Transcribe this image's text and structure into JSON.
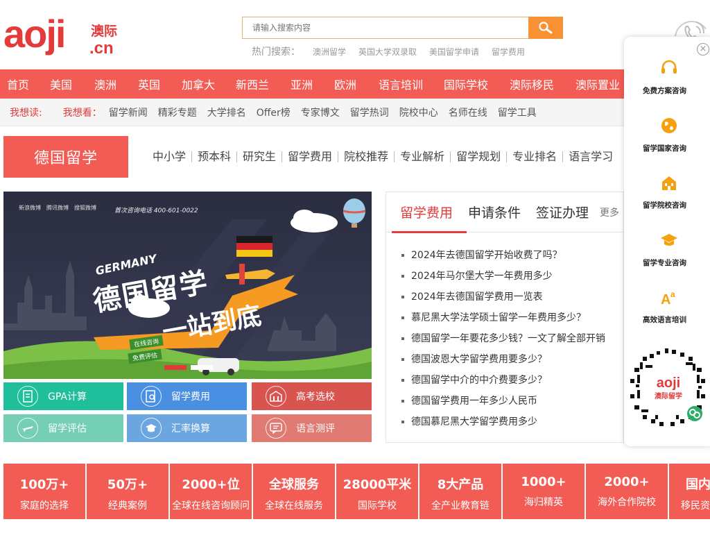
{
  "header": {
    "logo_text": "aoji",
    "logo_cn": "澳际",
    "logo_domain": ".cn",
    "search_placeholder": "请输入搜索内容",
    "hot_label": "热门搜索：",
    "hot_keywords": [
      "澳洲留学",
      "英国大学双录取",
      "美国留学申请",
      "留学费用"
    ]
  },
  "nav": [
    "首页",
    "美国",
    "澳洲",
    "英国",
    "加拿大",
    "新西兰",
    "亚洲",
    "欧洲",
    "语言培训",
    "国际学校",
    "澳际移民",
    "澳际置业"
  ],
  "subnav": {
    "label1": "我想读:",
    "label2": "我想看：",
    "items": [
      "留学新闻",
      "精彩专题",
      "大学排名",
      "Offer榜",
      "专家博文",
      "留学热词",
      "院校中心",
      "名师在线",
      "留学工具"
    ]
  },
  "section": {
    "title": "德国留学",
    "links": [
      "中小学",
      "预本科",
      "研究生",
      "留学费用",
      "院校推荐",
      "专业解析",
      "留学规划",
      "专业排名",
      "语言学习"
    ]
  },
  "banner": {
    "top_items": [
      "新浪微博",
      "腾讯微博",
      "搜狐微博"
    ],
    "phone": "首次咨询电话 400-601-0022",
    "germany": "GERMANY",
    "line1": "德国留学",
    "line2": "一站到底",
    "btn1": "在线咨询",
    "btn2": "免费评估"
  },
  "tools": [
    {
      "label": "GPA计算",
      "color": "#1fbf9c",
      "icon": "document-icon"
    },
    {
      "label": "留学费用",
      "color": "#4a90e2",
      "icon": "search-doc-icon"
    },
    {
      "label": "高考选校",
      "color": "#d9534f",
      "icon": "school-icon"
    },
    {
      "label": "留学评估",
      "color": "#74cfb4",
      "icon": "plane-icon"
    },
    {
      "label": "汇率换算",
      "color": "#6ba6e0",
      "icon": "graduation-cap-icon"
    },
    {
      "label": "语言测评",
      "color": "#e07a72",
      "icon": "chat-icon"
    }
  ],
  "news": {
    "tabs": [
      "留学费用",
      "申请条件",
      "签证办理"
    ],
    "more": "更多",
    "items": [
      "2024年去德国留学开始收费了吗？",
      "2024年马尔堡大学一年费用多少",
      "2024年去德国留学费用一览表",
      "慕尼黑大学法学硕士留学一年费用多少？",
      "德国留学一年要花多少钱？一文了解全部开销",
      "德国波恩大学留学费用要多少？",
      "德国留学中介的中介费要多少？",
      "德国留学费用一年多少人民币",
      "德国慕尼黑大学留学费用多少"
    ]
  },
  "stats": [
    {
      "big": "100万+",
      "small": "家庭的选择"
    },
    {
      "big": "50万+",
      "small": "经典案例"
    },
    {
      "big": "2000+位",
      "small": "全球在线咨询顾问"
    },
    {
      "big": "全球服务",
      "small": "全球在线服务"
    },
    {
      "big": "28000平米",
      "small": "国际学校"
    },
    {
      "big": "8大产品",
      "small": "全产业教育链"
    },
    {
      "big": "1000+",
      "small": "海归精英"
    },
    {
      "big": "2000+",
      "small": "海外合作院校"
    },
    {
      "big": "国内",
      "small": "移民资"
    }
  ],
  "side": {
    "items": [
      "免费方案咨询",
      "留学国家咨询",
      "留学院校咨询",
      "留学专业咨询",
      "高效语言培训"
    ],
    "qr_text": "澳际留学",
    "qr_logo": "aoji"
  },
  "colors": {
    "brand": "#f25c54",
    "search_btn": "#f89133"
  }
}
